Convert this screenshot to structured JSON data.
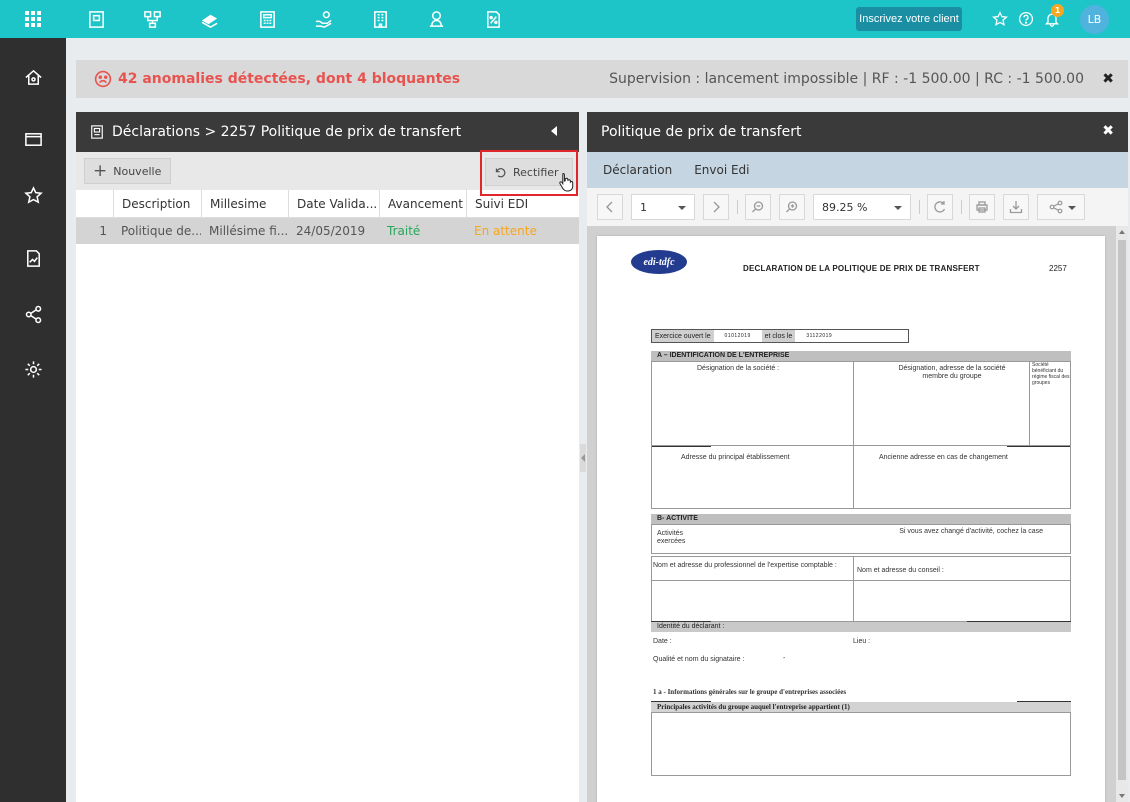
{
  "topbar": {
    "cta_label": "Inscrivez votre client",
    "notification_count": "1",
    "avatar_initials": "LB",
    "colors": {
      "background": "#1ec5c8",
      "cta": "#1a8fa3",
      "badge": "#f5a623"
    }
  },
  "alert": {
    "anomalies": "42 anomalies détectées, dont 4 bloquantes",
    "supervision": "Supervision : lancement impossible | RF : -1 500.00 | RC : -1 500.00",
    "close": "✖"
  },
  "left_panel": {
    "breadcrumb": "Déclarations > 2257 Politique de prix de transfert",
    "new_button": "Nouvelle",
    "rectifier_button": "Rectifier",
    "columns": [
      "Description",
      "Millesime",
      "Date Valida...",
      "Avancement",
      "Suivi EDI"
    ],
    "rows": [
      {
        "index": "1",
        "description": "Politique de...",
        "millesime": "Millésime fi...",
        "date": "24/05/2019",
        "avancement": "Traité",
        "suivi": "En attente"
      }
    ],
    "colors": {
      "traite": "#2aa55a",
      "en_attente": "#f5a623"
    }
  },
  "right_panel": {
    "title": "Politique de prix de transfert",
    "close": "✖",
    "tabs": [
      "Déclaration",
      "Envoi Edi"
    ],
    "viewer": {
      "page": "1",
      "zoom": "89.25 %"
    }
  },
  "document": {
    "logo": "edi-tdfc",
    "title": "DECLARATION DE LA POLITIQUE DE PRIX DE TRANSFERT",
    "number": "2257",
    "exercice_ouvert": "Exercice ouvert le",
    "exercice_ouvert_val": "01012019",
    "exercice_clos": "et clos le",
    "exercice_clos_val": "31122019",
    "section_a": "A – IDENTIFICATION DE L'ENTREPRISE",
    "designation": "Désignation de la société :",
    "designation_groupe": "Désignation, adresse de la société membre du groupe",
    "beneficiaire": "Société bénéficiant du régime fiscal des groupes",
    "adresse_principal": "Adresse du principal établissement",
    "ancienne_adresse": "Ancienne adresse en cas de changement",
    "section_b": "B- ACTIVITE",
    "activites": "Activités exercées",
    "changement": "Si vous avez changé d'activité, cochez la case",
    "expert": "Nom et adresse du professionnel de l'expertise comptable :",
    "conseil": "Nom et adresse du conseil :",
    "identite": "Identité du déclarant :",
    "date": "Date :",
    "lieu": "Lieu :",
    "signataire": "Qualité et nom du signataire :",
    "signataire_val": "-",
    "infos_generales": "1 a - Informations générales sur le groupe d'entreprises associées",
    "activites_groupe": "Principales activités du groupe auquel l'entreprise appartient (1)"
  }
}
